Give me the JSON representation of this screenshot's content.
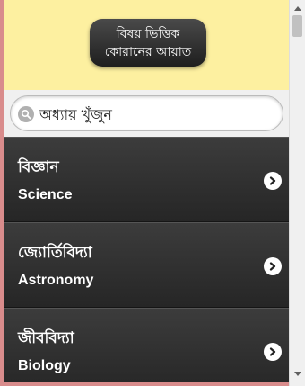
{
  "header": {
    "title_line1": "বিষয় ভিত্তিক",
    "title_line2": "কোরানের আয়াত"
  },
  "search": {
    "placeholder": "অধ্যায় খুঁজুন",
    "icon": "search-icon"
  },
  "items": [
    {
      "bn": "বিজ্ঞান",
      "en": "Science"
    },
    {
      "bn": "জ্যোর্তিবিদ্যা",
      "en": "Astronomy"
    },
    {
      "bn": "জীববিদ্যা",
      "en": "Biology"
    }
  ],
  "colors": {
    "header_bg": "#fdf0a0",
    "list_bg": "#2e2e2e",
    "frame": "#d98c8c"
  }
}
